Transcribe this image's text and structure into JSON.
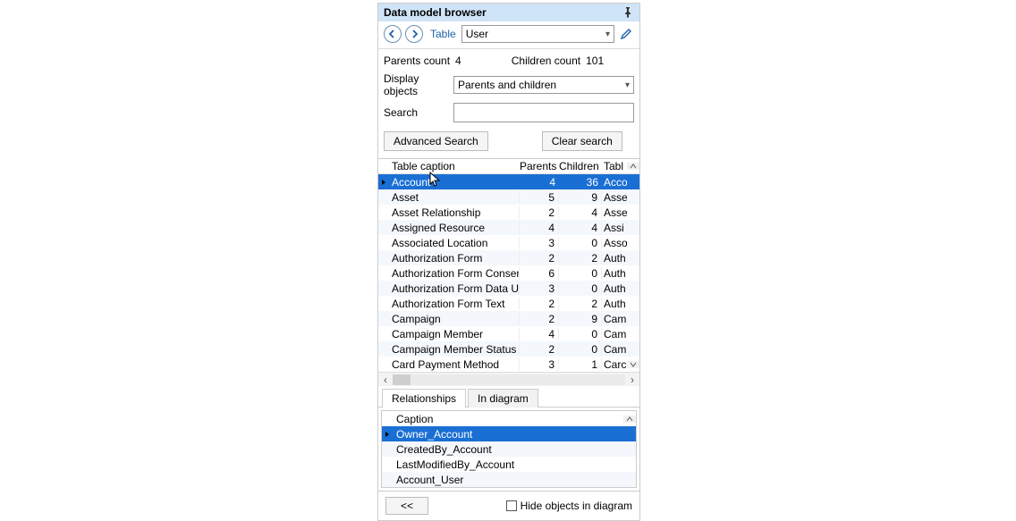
{
  "title": "Data model browser",
  "toolbar": {
    "table_label": "Table",
    "table_value": "User"
  },
  "counts": {
    "parents_label": "Parents count",
    "parents_value": "4",
    "children_label": "Children count",
    "children_value": "101"
  },
  "display": {
    "label": "Display objects",
    "value": "Parents and children"
  },
  "search": {
    "label": "Search",
    "value": ""
  },
  "buttons": {
    "advanced": "Advanced Search",
    "clear": "Clear search",
    "back2": "<<",
    "hide_label": "Hide objects in diagram"
  },
  "grid": {
    "headers": {
      "caption": "Table caption",
      "parents": "Parents",
      "children": "Children",
      "table": "Tabl"
    },
    "rows": [
      {
        "caption": "Account",
        "parents": 4,
        "children": 36,
        "table": "Acco",
        "selected": true
      },
      {
        "caption": "Asset",
        "parents": 5,
        "children": 9,
        "table": "Asse"
      },
      {
        "caption": "Asset Relationship",
        "parents": 2,
        "children": 4,
        "table": "Asse"
      },
      {
        "caption": "Assigned Resource",
        "parents": 4,
        "children": 4,
        "table": "Assi"
      },
      {
        "caption": "Associated Location",
        "parents": 3,
        "children": 0,
        "table": "Asso"
      },
      {
        "caption": "Authorization Form",
        "parents": 2,
        "children": 2,
        "table": "Auth"
      },
      {
        "caption": "Authorization Form Consent",
        "parents": 6,
        "children": 0,
        "table": "Auth"
      },
      {
        "caption": "Authorization Form Data Use",
        "parents": 3,
        "children": 0,
        "table": "Auth"
      },
      {
        "caption": "Authorization Form Text",
        "parents": 2,
        "children": 2,
        "table": "Auth"
      },
      {
        "caption": "Campaign",
        "parents": 2,
        "children": 9,
        "table": "Cam"
      },
      {
        "caption": "Campaign Member",
        "parents": 4,
        "children": 0,
        "table": "Cam"
      },
      {
        "caption": "Campaign Member Status",
        "parents": 2,
        "children": 0,
        "table": "Cam"
      },
      {
        "caption": "Card Payment Method",
        "parents": 3,
        "children": 1,
        "table": "Carc"
      }
    ]
  },
  "tabs": {
    "relationships": "Relationships",
    "in_diagram": "In diagram"
  },
  "rel_grid": {
    "header": "Caption",
    "rows": [
      {
        "caption": "Owner_Account",
        "selected": true
      },
      {
        "caption": "CreatedBy_Account"
      },
      {
        "caption": "LastModifiedBy_Account"
      },
      {
        "caption": "Account_User"
      }
    ]
  }
}
